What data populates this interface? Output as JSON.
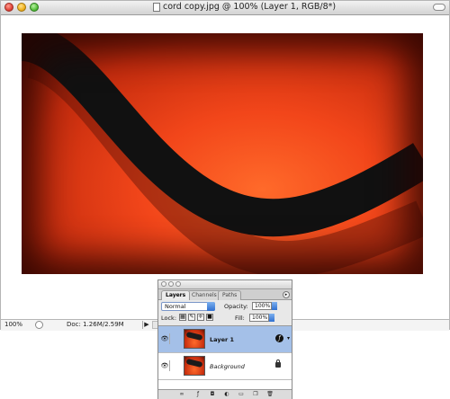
{
  "document": {
    "title": "cord copy.jpg @ 100% (Layer 1, RGB/8*)",
    "zoom": "100%",
    "doc_size": "Doc: 1.26M/2.59M"
  },
  "layers_panel": {
    "tabs": [
      {
        "label": "Layers",
        "active": true
      },
      {
        "label": "Channels",
        "active": false
      },
      {
        "label": "Paths",
        "active": false
      }
    ],
    "blend_mode": "Normal",
    "opacity_label": "Opacity:",
    "opacity_value": "100%",
    "lock_label": "Lock:",
    "fill_label": "Fill:",
    "fill_value": "100%",
    "layers": [
      {
        "name": "Layer 1",
        "selected": true,
        "has_effects": true
      },
      {
        "name": "Background",
        "selected": false,
        "locked": true
      }
    ]
  },
  "colors": {
    "selection": "#a4c0e8",
    "photo_red": "#f2461a"
  }
}
